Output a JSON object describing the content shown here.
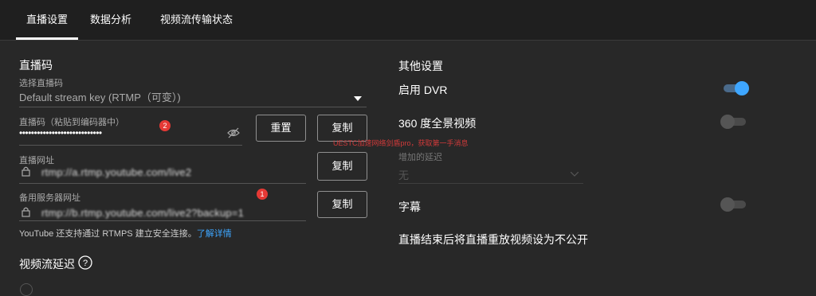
{
  "tabs": [
    "直播设置",
    "数据分析",
    "视频流传输状态"
  ],
  "stream_key": {
    "section_title": "直播码",
    "select_label": "选择直播码",
    "select_value": "Default stream key (RTMP（可变）)",
    "key_label": "直播码（粘贴到编码器中）",
    "key_value": "••••••••••••••••••••••••••••",
    "reset_label": "重置",
    "copy_label": "复制",
    "badge": "2"
  },
  "stream_url": {
    "label": "直播网址",
    "value": "rtmp://a.rtmp.youtube.com/live2",
    "copy_label": "复制"
  },
  "backup_url": {
    "label": "备用服务器网址",
    "value": "rtmp://b.rtmp.youtube.com/live2?backup=1",
    "copy_label": "复制",
    "badge": "1"
  },
  "rtmps_note": "YouTube 还支持通过 RTMPS 建立安全连接。",
  "rtmps_link": "了解详情",
  "latency_title": "视频流延迟",
  "watermark": "UESTC加速网络剑盾pro，获取第一手消息",
  "other": {
    "title": "其他设置",
    "dvr_label": "启用 DVR",
    "dvr_on": true,
    "vr360_label": "360 度全景视频",
    "vr360_on": false,
    "delay_label": "增加的延迟",
    "delay_value": "无",
    "captions_label": "字幕",
    "captions_on": false,
    "unlisted_label": "直播结束后将直播重放视频设为不公开"
  },
  "colors": {
    "accent": "#3ea6ff",
    "badge": "#e53935",
    "background": "#282828"
  }
}
